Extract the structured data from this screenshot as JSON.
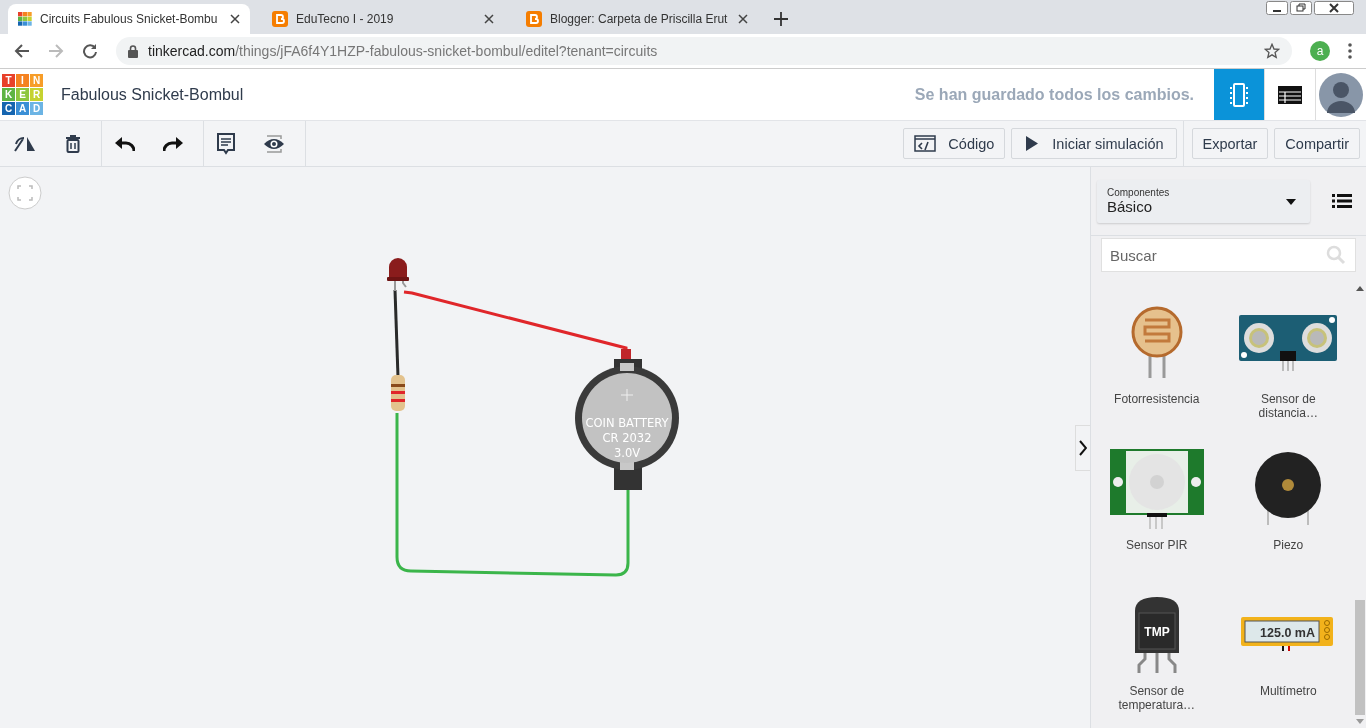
{
  "browser": {
    "tabs": [
      {
        "title": "Circuits Fabulous Snicket-Bombu",
        "selected": true,
        "kind": "tinkercad"
      },
      {
        "title": "EduTecno I - 2019",
        "selected": false,
        "kind": "blogger"
      },
      {
        "title": "Blogger: Carpeta de Priscilla Erut",
        "selected": false,
        "kind": "blogger"
      }
    ],
    "url_host": "tinkercad.com",
    "url_path": "/things/jFA6f4Y1HZP-fabulous-snicket-bombul/editel?tenant=circuits",
    "profile_initial": "a"
  },
  "logo": [
    {
      "letter": "T",
      "color": "#e8412b"
    },
    {
      "letter": "I",
      "color": "#f58220"
    },
    {
      "letter": "N",
      "color": "#f79d28"
    },
    {
      "letter": "K",
      "color": "#5eb443"
    },
    {
      "letter": "E",
      "color": "#8dc63f"
    },
    {
      "letter": "R",
      "color": "#c5d230"
    },
    {
      "letter": "C",
      "color": "#1565b0"
    },
    {
      "letter": "A",
      "color": "#3a8fd6"
    },
    {
      "letter": "D",
      "color": "#6cb4e4"
    }
  ],
  "app": {
    "title": "Fabulous Snicket-Bombul",
    "save_status": "Se han guardado todos los cambios.",
    "view_modes": [
      {
        "kind": "circuit",
        "selected": true
      },
      {
        "kind": "list",
        "selected": false
      }
    ]
  },
  "toolbar": {
    "code_button": "Código",
    "simulate_button": "Iniciar simulación",
    "export_button": "Exportar",
    "share_button": "Compartir"
  },
  "canvas": {
    "battery_lines": [
      "COIN BATTERY",
      "CR 2032",
      "3.0V"
    ]
  },
  "panel": {
    "category_label": "Componentes",
    "category": "Básico",
    "search_placeholder": "Buscar",
    "components": [
      {
        "name": "Fotorresistencia",
        "kind": "photoresistor"
      },
      {
        "name": "Sensor de distancia…",
        "kind": "ultrasonic"
      },
      {
        "name": "Sensor PIR",
        "kind": "pir"
      },
      {
        "name": "Piezo",
        "kind": "piezo"
      },
      {
        "name": "Sensor de temperatura…",
        "kind": "tmp",
        "chip_label": "TMP"
      },
      {
        "name": "Multímetro",
        "kind": "multimeter",
        "display": "125.0 mA"
      }
    ]
  }
}
